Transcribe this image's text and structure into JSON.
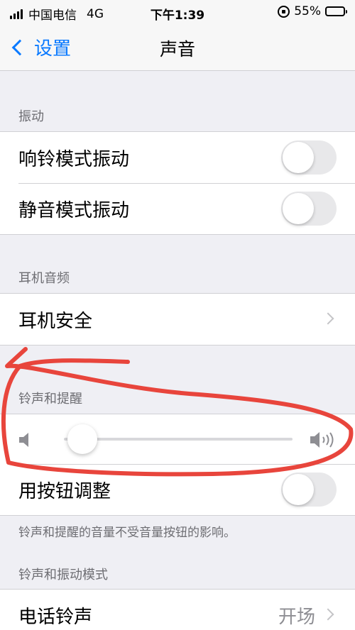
{
  "status_bar": {
    "carrier": "中国电信",
    "network": "4G",
    "time": "下午1:39",
    "battery": "55%",
    "battery_level": 0.55
  },
  "nav": {
    "back_label": "设置",
    "title": "声音"
  },
  "sections": {
    "vibration": {
      "header": "振动",
      "ring_vibrate": {
        "label": "响铃模式振动",
        "on": false
      },
      "silent_vibrate": {
        "label": "静音模式振动",
        "on": false
      }
    },
    "headphone": {
      "header": "耳机音频",
      "safety": {
        "label": "耳机安全"
      }
    },
    "ringer": {
      "header": "铃声和提醒",
      "volume_level": 0.08,
      "change_with_buttons": {
        "label": "用按钮调整",
        "on": false
      },
      "footer": "铃声和提醒的音量不受音量按钮的影响。"
    },
    "patterns": {
      "header": "铃声和振动模式",
      "ringtone": {
        "label": "电话铃声",
        "value": "开场"
      }
    }
  },
  "colors": {
    "accent": "#0a7aff",
    "annotation": "#e8453c"
  },
  "icons": [
    "back-chevron-icon",
    "signal-icon",
    "rotation-lock-icon",
    "battery-icon",
    "chevron-right-icon",
    "volume-low-icon",
    "volume-high-icon"
  ]
}
